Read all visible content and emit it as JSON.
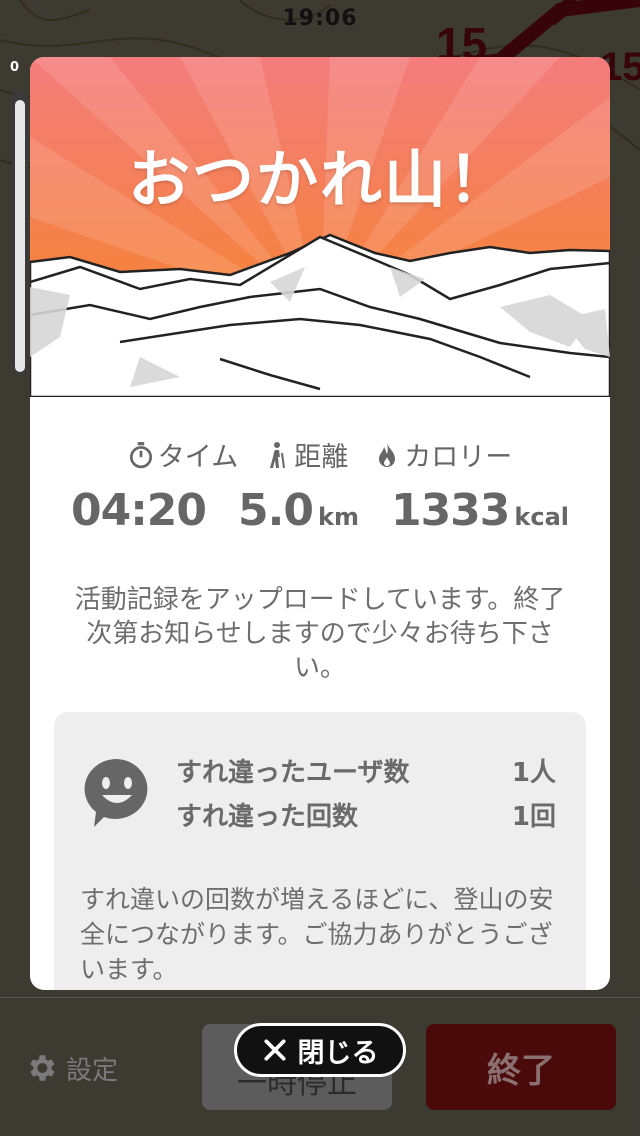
{
  "status_bar": {
    "time": "19:06"
  },
  "map": {
    "scale_label": "0",
    "route_labels": [
      "15",
      "15"
    ]
  },
  "toolbar": {
    "settings_label": "設定",
    "pause_label": "一時停止",
    "finish_label": "終了"
  },
  "modal": {
    "title": "おつかれ山！",
    "stats": {
      "time_label": "タイム",
      "distance_label": "距離",
      "calories_label": "カロリー",
      "time_value": "04:20",
      "distance_value": "5.0",
      "distance_unit": "km",
      "calories_value": "1333",
      "calories_unit": "kcal"
    },
    "upload_message": "活動記録をアップロードしています。終了次第お知らせしますので少々お待ち下さい。",
    "encounter": {
      "users_label": "すれ違ったユーザ数",
      "users_value": "1人",
      "count_label": "すれ違った回数",
      "count_value": "1回",
      "note": "すれ違いの回数が増えるほどに、登山の安全につながります。ご協力ありがとうございます。"
    }
  },
  "close_button": {
    "label": "閉じる"
  },
  "colors": {
    "hero_top": "#f47c7c",
    "hero_bottom": "#f6861e",
    "route_red": "#c8102e",
    "text_gray": "#666666"
  },
  "icons": {
    "timer": "stopwatch-icon",
    "distance": "hiker-icon",
    "calories": "flame-icon",
    "encounter": "smiley-chat-icon",
    "settings": "gear-icon",
    "close": "close-icon"
  }
}
